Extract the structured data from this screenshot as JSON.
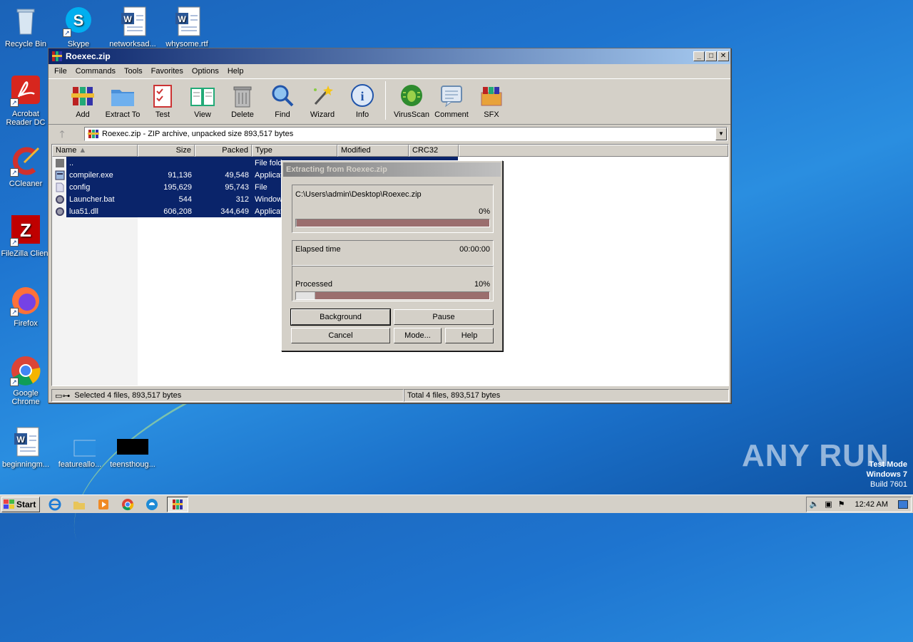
{
  "desktop": {
    "icons": [
      {
        "label": "Recycle Bin"
      },
      {
        "label": "Skype"
      },
      {
        "label": "networksad..."
      },
      {
        "label": "whysome.rtf"
      },
      {
        "label": "Acrobat Reader DC"
      },
      {
        "label": "CCleaner"
      },
      {
        "label": "FileZilla Client"
      },
      {
        "label": "Firefox"
      },
      {
        "label": "Google Chrome"
      },
      {
        "label": "beginningm..."
      },
      {
        "label": "featureallo..."
      },
      {
        "label": "teensthoug..."
      }
    ],
    "watermark": {
      "line1": "Test Mode",
      "line2": "Windows 7",
      "line3": "Build 7601"
    },
    "anyrun": "ANY RUN"
  },
  "window": {
    "title": "Roexec.zip",
    "menu": [
      "File",
      "Commands",
      "Tools",
      "Favorites",
      "Options",
      "Help"
    ],
    "toolbar": [
      "Add",
      "Extract To",
      "Test",
      "View",
      "Delete",
      "Find",
      "Wizard",
      "Info",
      "VirusScan",
      "Comment",
      "SFX"
    ],
    "address": "Roexec.zip - ZIP archive, unpacked size 893,517 bytes",
    "columns": [
      "Name",
      "Size",
      "Packed",
      "Type",
      "Modified",
      "CRC32"
    ],
    "files": [
      {
        "name": "..",
        "size": "",
        "packed": "",
        "type": "File fold"
      },
      {
        "name": "compiler.exe",
        "size": "91,136",
        "packed": "49,548",
        "type": "Applicat"
      },
      {
        "name": "config",
        "size": "195,629",
        "packed": "95,743",
        "type": "File"
      },
      {
        "name": "Launcher.bat",
        "size": "544",
        "packed": "312",
        "type": "Window"
      },
      {
        "name": "lua51.dll",
        "size": "606,208",
        "packed": "344,649",
        "type": "Applicat"
      }
    ],
    "status_left": "Selected 4 files, 893,517 bytes",
    "status_right": "Total 4 files, 893,517 bytes"
  },
  "dialog": {
    "title": "Extracting from Roexec.zip",
    "path": "C:\\Users\\admin\\Desktop\\Roexec.zip",
    "file_progress_label": "0%",
    "file_progress": 0,
    "elapsed_label": "Elapsed time",
    "elapsed_value": "00:00:00",
    "processed_label": "Processed",
    "processed_value": "10%",
    "processed_progress": 0.1,
    "buttons": {
      "background": "Background",
      "pause": "Pause",
      "cancel": "Cancel",
      "mode": "Mode...",
      "help": "Help"
    }
  },
  "taskbar": {
    "start": "Start",
    "clock": "12:42 AM"
  },
  "colors": {
    "selection": "#0a246a",
    "desktop": "#1e74cf",
    "progress": "#9b6e6e"
  }
}
